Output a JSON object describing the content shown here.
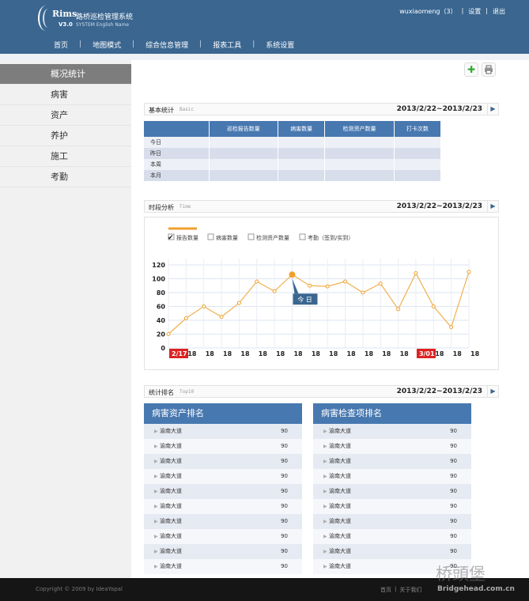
{
  "header": {
    "logo": "Rims",
    "system_name": "路桥巡检管理系统",
    "version": "V3.0",
    "subtitle": "SYSTEM English Name",
    "user": "wuxiaomeng（3）",
    "settings": "设置",
    "logout": "退出"
  },
  "nav": [
    "首页",
    "地图模式",
    "综合信息管理",
    "报表工具",
    "系统设置"
  ],
  "sidebar": [
    "概况统计",
    "病害",
    "资产",
    "养护",
    "施工",
    "考勤"
  ],
  "basic": {
    "title": "基本统计",
    "en": "Basic",
    "date": "2013/2/22~2013/2/23",
    "columns": [
      "",
      "巡检报告数量",
      "病害数量",
      "检测资产数量",
      "打卡次数"
    ],
    "rows": [
      "今日",
      "昨日",
      "本周",
      "本月"
    ]
  },
  "time": {
    "title": "时段分析",
    "en": "Time",
    "date": "2013/2/22~2013/2/23"
  },
  "rankings": {
    "title": "统计排名",
    "en": "Top10",
    "date": "2013/2/22~2013/2/23"
  },
  "chart_data": {
    "type": "line",
    "legend": [
      "报告数量",
      "病害数量",
      "检测资产数量",
      "考勤（签到/实到）"
    ],
    "x": [
      "2/17",
      "18",
      "18",
      "18",
      "18",
      "18",
      "18",
      "18",
      "18",
      "18",
      "18",
      "18",
      "18",
      "18",
      "3/01",
      "18",
      "18",
      "18"
    ],
    "values": [
      20,
      43,
      60,
      45,
      65,
      96,
      82,
      106,
      90,
      89,
      96,
      80,
      93,
      56,
      108,
      60,
      30,
      110
    ],
    "yticks": [
      0,
      20,
      40,
      60,
      80,
      100,
      120
    ],
    "ylim": [
      0,
      120
    ],
    "tooltip": "今 日",
    "highlight_index": 7
  },
  "rank_left": {
    "title": "病害资产排名",
    "items": [
      {
        "name": "渝南大道",
        "value": "90"
      },
      {
        "name": "渝南大道",
        "value": "90"
      },
      {
        "name": "渝南大道",
        "value": "90"
      },
      {
        "name": "渝南大道",
        "value": "90"
      },
      {
        "name": "渝南大道",
        "value": "90"
      },
      {
        "name": "渝南大道",
        "value": "90"
      },
      {
        "name": "渝南大道",
        "value": "90"
      },
      {
        "name": "渝南大道",
        "value": "90"
      },
      {
        "name": "渝南大道",
        "value": "90"
      },
      {
        "name": "渝南大道",
        "value": "90"
      }
    ]
  },
  "rank_right": {
    "title": "病害检查项排名",
    "items": [
      {
        "name": "渝南大道",
        "value": "90"
      },
      {
        "name": "渝南大道",
        "value": "90"
      },
      {
        "name": "渝南大道",
        "value": "90"
      },
      {
        "name": "渝南大道",
        "value": "90"
      },
      {
        "name": "渝南大道",
        "value": "90"
      },
      {
        "name": "渝南大道",
        "value": "90"
      },
      {
        "name": "渝南大道",
        "value": "90"
      },
      {
        "name": "渝南大道",
        "value": "90"
      },
      {
        "name": "渝南大道",
        "value": "90"
      },
      {
        "name": "渝南大道",
        "value": "90"
      }
    ]
  },
  "footer": {
    "copyright": "Copyright © 2009 by IdeaYapal",
    "links": [
      "首页",
      "关于我们"
    ]
  },
  "watermark": {
    "cn": "桥頭堡",
    "url": "Bridgehead.com.cn"
  }
}
